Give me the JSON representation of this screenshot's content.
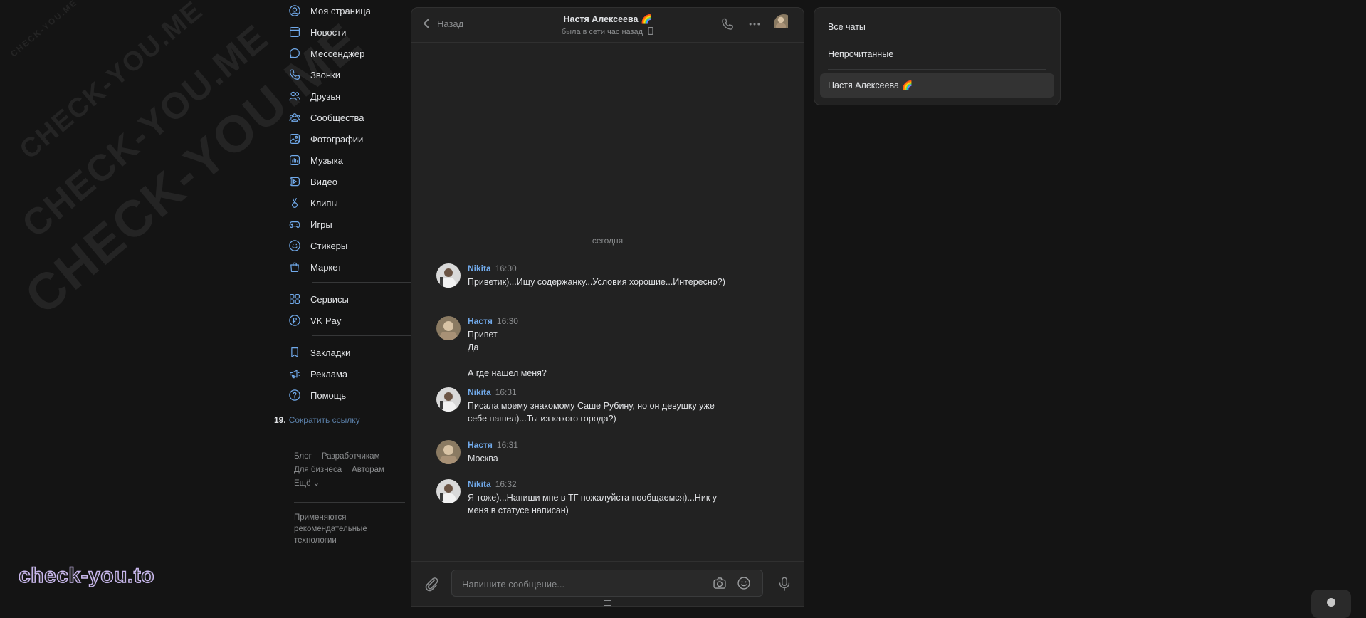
{
  "watermark": {
    "text": "CHECK-YOU.ME",
    "brand": "check-you.to"
  },
  "nav": {
    "primary": [
      {
        "label": "Моя страница",
        "icon": "user-circle-icon"
      },
      {
        "label": "Новости",
        "icon": "newspaper-icon"
      },
      {
        "label": "Мессенджер",
        "icon": "message-bubble-icon"
      },
      {
        "label": "Звонки",
        "icon": "phone-icon"
      },
      {
        "label": "Друзья",
        "icon": "friends-icon"
      },
      {
        "label": "Сообщества",
        "icon": "communities-icon"
      },
      {
        "label": "Фотографии",
        "icon": "photo-icon"
      },
      {
        "label": "Музыка",
        "icon": "music-icon"
      },
      {
        "label": "Видео",
        "icon": "video-icon"
      },
      {
        "label": "Клипы",
        "icon": "clips-icon"
      },
      {
        "label": "Игры",
        "icon": "gamepad-icon"
      },
      {
        "label": "Стикеры",
        "icon": "smile-icon"
      },
      {
        "label": "Маркет",
        "icon": "shopping-bag-icon"
      }
    ],
    "services": [
      {
        "label": "Сервисы",
        "icon": "apps-grid-icon"
      },
      {
        "label": "VK Pay",
        "icon": "vkpay-icon"
      }
    ],
    "tertiary": [
      {
        "label": "Закладки",
        "icon": "bookmark-icon"
      },
      {
        "label": "Реклама",
        "icon": "megaphone-icon"
      },
      {
        "label": "Помощь",
        "icon": "help-icon"
      }
    ],
    "shorten_number": "19.",
    "shorten_link": "Сократить ссылку",
    "footer_links": [
      "Блог",
      "Разработчикам",
      "Для бизнеса",
      "Авторам"
    ],
    "more": "Ещё",
    "footer_note": "Применяются рекомендательные технологии"
  },
  "chat": {
    "back_label": "Назад",
    "peer_name": "Настя Алексеева 🌈",
    "peer_status": "была в сети час назад",
    "date_separator": "сегодня",
    "messages": [
      {
        "author": "Nikita",
        "time": "16:30",
        "text": "Приветик)...Ищу содержанку...Условия хорошие...Интересно?)"
      },
      {
        "author": "Настя",
        "time": "16:30",
        "text": "Привет\nДа\n\nА где нашел меня?"
      },
      {
        "author": "Nikita",
        "time": "16:31",
        "text": "Писала моему знакомому Саше Рубину, но он девушку уже себе нашел)...Ты из какого города?)"
      },
      {
        "author": "Настя",
        "time": "16:31",
        "text": "Москва"
      },
      {
        "author": "Nikita",
        "time": "16:32",
        "text": "Я тоже)...Напиши мне в ТГ пожалуйста пообщаемся)...Ник у меня в статусе написан)"
      }
    ],
    "composer_placeholder": "Напишите сообщение..."
  },
  "filters": {
    "all_chats": "Все чаты",
    "unread": "Непрочитанные",
    "active_chat": "Настя Алексеева 🌈"
  },
  "colors": {
    "background": "#141414",
    "panel": "#222222",
    "accent_name": "#71aaeb",
    "link": "#5a7fa8"
  }
}
